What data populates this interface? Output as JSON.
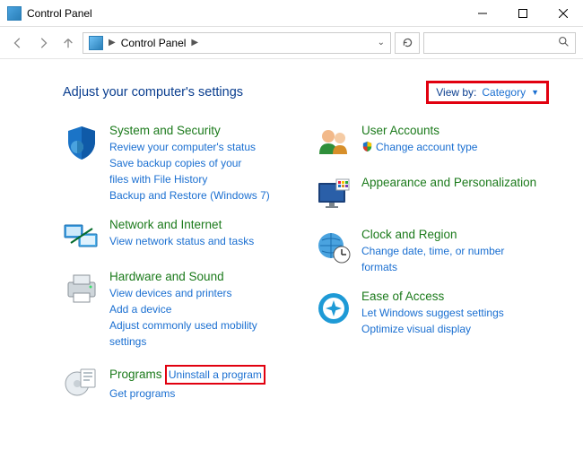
{
  "window": {
    "title": "Control Panel"
  },
  "address": {
    "crumb": "Control Panel"
  },
  "heading": "Adjust your computer's settings",
  "viewby": {
    "label": "View by:",
    "value": "Category"
  },
  "left": [
    {
      "title": "System and Security",
      "subs": [
        "Review your computer's status",
        "Save backup copies of your files with File History",
        "Backup and Restore (Windows 7)"
      ]
    },
    {
      "title": "Network and Internet",
      "subs": [
        "View network status and tasks"
      ]
    },
    {
      "title": "Hardware and Sound",
      "subs": [
        "View devices and printers",
        "Add a device",
        "Adjust commonly used mobility settings"
      ]
    },
    {
      "title": "Programs",
      "subs": [
        "Uninstall a program",
        "Get programs"
      ]
    }
  ],
  "right": [
    {
      "title": "User Accounts",
      "subs": [
        "Change account type"
      ]
    },
    {
      "title": "Appearance and Personalization",
      "subs": []
    },
    {
      "title": "Clock and Region",
      "subs": [
        "Change date, time, or number formats"
      ]
    },
    {
      "title": "Ease of Access",
      "subs": [
        "Let Windows suggest settings",
        "Optimize visual display"
      ]
    }
  ]
}
